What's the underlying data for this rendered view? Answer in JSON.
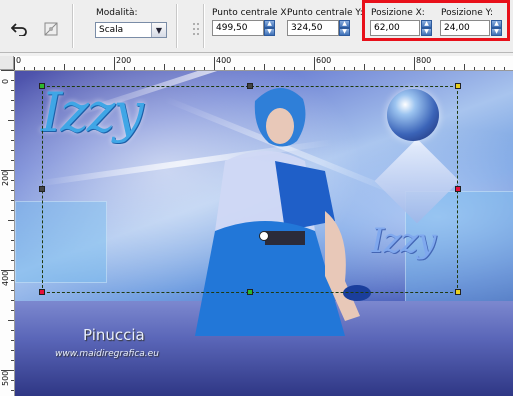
{
  "toolbar": {
    "apply_icon": "undo-arrow-icon",
    "reset_icon": "deformation-reset-icon",
    "mode_label": "Modalità:",
    "mode_value": "Scala",
    "cx_label": "Punto centrale X:",
    "cx_value": "499,50",
    "cy_label": "Punto centrale Y:",
    "cy_value": "324,50",
    "px_label": "Posizione X:",
    "px_value": "62,00",
    "py_label": "Posizione Y:",
    "py_value": "24,00",
    "highlight_color": "#e8101a"
  },
  "ruler": {
    "top_labels": [
      "0",
      "200",
      "400",
      "600",
      "800"
    ],
    "left_labels": [
      "0",
      "200",
      "400",
      "500"
    ]
  },
  "canvas": {
    "title_large": "Izzy",
    "title_small": "Izzy",
    "watermark_name": "Pinuccia",
    "watermark_url": "www.maidiregrafica.eu",
    "accent_color": "#3fa6e6"
  }
}
